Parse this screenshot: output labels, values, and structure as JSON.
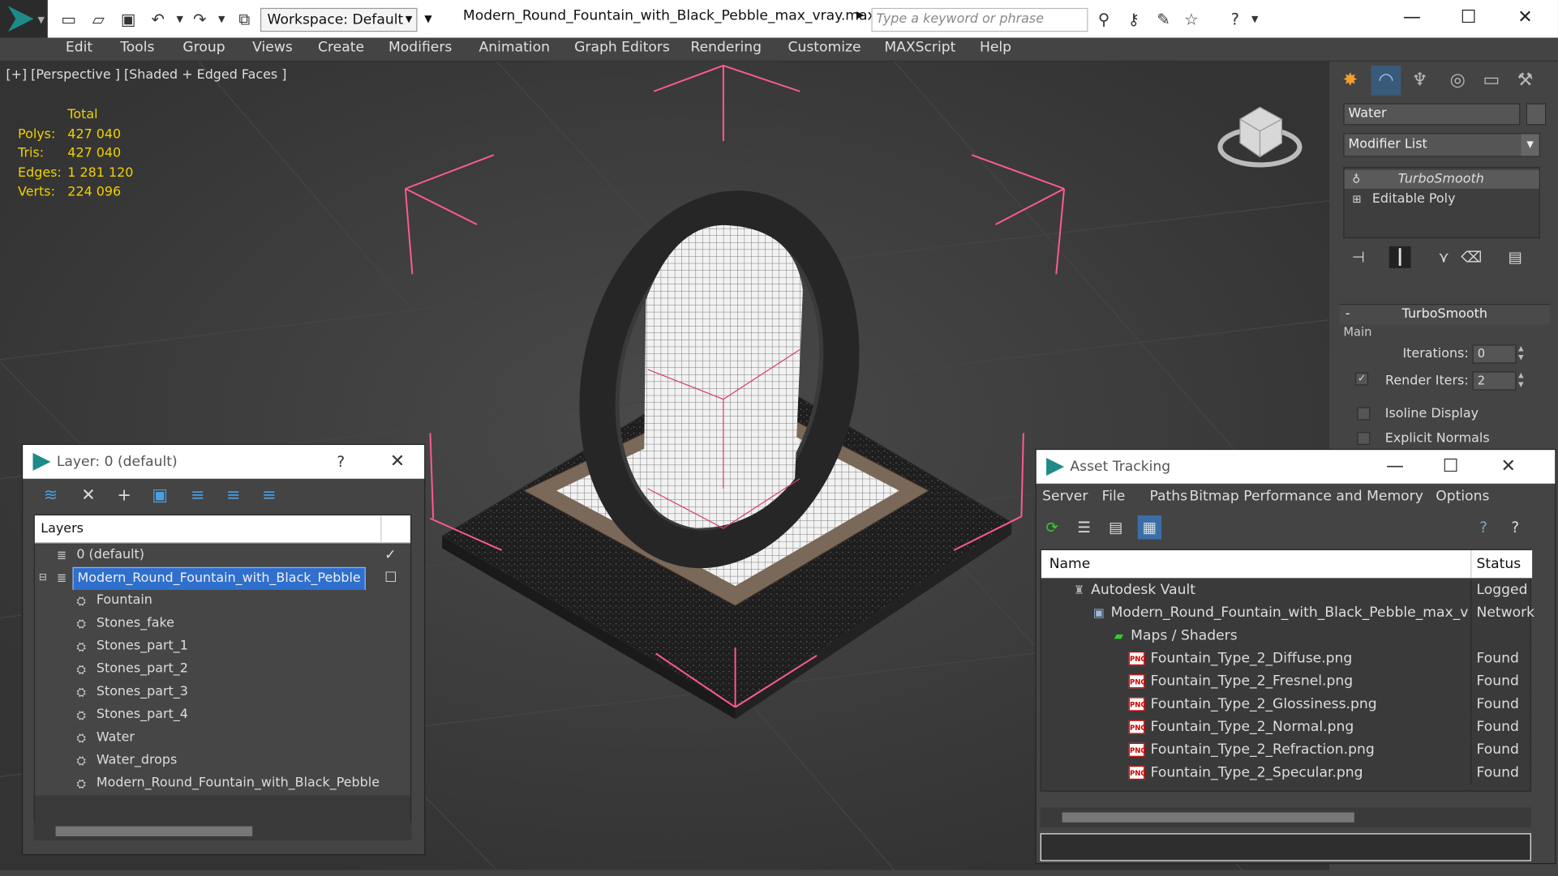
{
  "titlebar": {
    "workspace_label": "Workspace: Default",
    "document_title": "Modern_Round_Fountain_with_Black_Pebble_max_vray.max",
    "search_placeholder": "Type a keyword or phrase"
  },
  "menu": [
    "Edit",
    "Tools",
    "Group",
    "Views",
    "Create",
    "Modifiers",
    "Animation",
    "Graph Editors",
    "Rendering",
    "Customize",
    "MAXScript",
    "Help"
  ],
  "viewport": {
    "label": "[+] [Perspective ] [Shaded + Edged Faces ]",
    "stats": {
      "header": "Total",
      "rows": [
        {
          "key": "Polys:",
          "value": "427 040"
        },
        {
          "key": "Tris:",
          "value": "427 040"
        },
        {
          "key": "Edges:",
          "value": "1 281 120"
        },
        {
          "key": "Verts:",
          "value": "224 096"
        }
      ]
    },
    "colors": {
      "stats": "#f0d000",
      "selection_bracket": "#ff5a96",
      "background": "#3a3a3a"
    }
  },
  "command_panel": {
    "object_name": "Water",
    "modifier_list_label": "Modifier List",
    "stack": [
      "TurboSmooth",
      "Editable Poly"
    ],
    "turbosmooth": {
      "title": "TurboSmooth",
      "group": "Main",
      "iterations_label": "Iterations:",
      "iterations_value": "0",
      "render_iters_label": "Render Iters:",
      "render_iters_value": "2",
      "isoline_label": "Isoline Display",
      "explicit_normals_label": "Explicit Normals"
    }
  },
  "layer_dialog": {
    "title": "Layer: 0 (default)",
    "help": "?",
    "column_header": "Layers",
    "default_layer": "0 (default)",
    "selected_layer": "Modern_Round_Fountain_with_Black_Pebble",
    "children": [
      "Fountain",
      "Stones_fake",
      "Stones_part_1",
      "Stones_part_2",
      "Stones_part_3",
      "Stones_part_4",
      "Water",
      "Water_drops",
      "Modern_Round_Fountain_with_Black_Pebble"
    ]
  },
  "asset_dialog": {
    "title": "Asset Tracking",
    "menu": [
      "Server",
      "File",
      "Paths",
      "Bitmap Performance and Memory",
      "Options"
    ],
    "columns": {
      "name": "Name",
      "status": "Status"
    },
    "vault": {
      "name": "Autodesk Vault",
      "status": "Logged"
    },
    "scene_file": {
      "name": "Modern_Round_Fountain_with_Black_Pebble_max_vra...",
      "status": "Network"
    },
    "maps_group": "Maps / Shaders",
    "png_label": "PNG",
    "files": [
      {
        "name": "Fountain_Type_2_Diffuse.png",
        "status": "Found"
      },
      {
        "name": "Fountain_Type_2_Fresnel.png",
        "status": "Found"
      },
      {
        "name": "Fountain_Type_2_Glossiness.png",
        "status": "Found"
      },
      {
        "name": "Fountain_Type_2_Normal.png",
        "status": "Found"
      },
      {
        "name": "Fountain_Type_2_Refraction.png",
        "status": "Found"
      },
      {
        "name": "Fountain_Type_2_Specular.png",
        "status": "Found"
      }
    ]
  }
}
